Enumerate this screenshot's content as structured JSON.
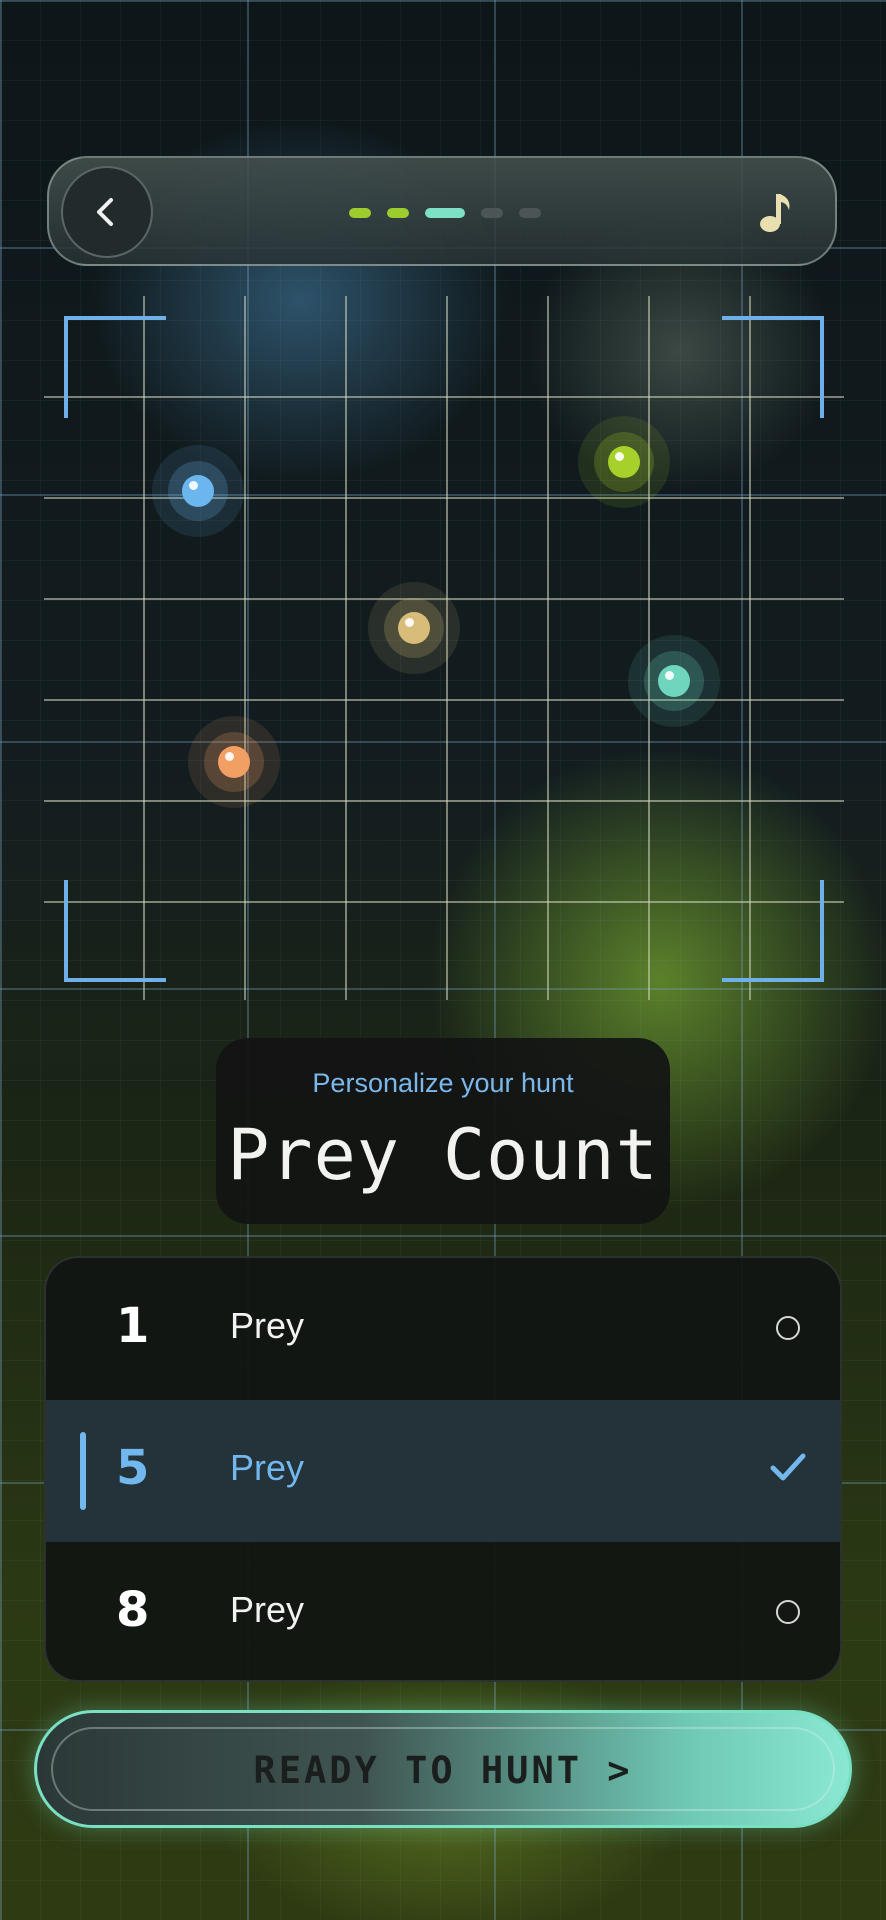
{
  "header": {
    "back_icon": "chevron-left-icon",
    "music_icon": "music-note-icon",
    "progress": {
      "total_steps": 5,
      "current_step": 3,
      "colors": [
        "#9ccc2e",
        "#9ccc2e",
        "#7ee0c4",
        "#4b5555",
        "#4b5555"
      ]
    }
  },
  "arena": {
    "prey_colors": [
      "#6cb6ee",
      "#a8d02a",
      "#d8bd7a",
      "#6fd6bd",
      "#f29f64"
    ]
  },
  "title_card": {
    "subtitle": "Personalize your hunt",
    "title": "Prey Count"
  },
  "options": [
    {
      "number": "1",
      "label": "Prey",
      "selected": false
    },
    {
      "number": "5",
      "label": "Prey",
      "selected": true
    },
    {
      "number": "8",
      "label": "Prey",
      "selected": false
    }
  ],
  "cta": {
    "label": "READY TO HUNT >"
  },
  "colors": {
    "accent_blue": "#72b8ee",
    "accent_mint": "#7ee0c4",
    "accent_green": "#9ccc2e"
  }
}
